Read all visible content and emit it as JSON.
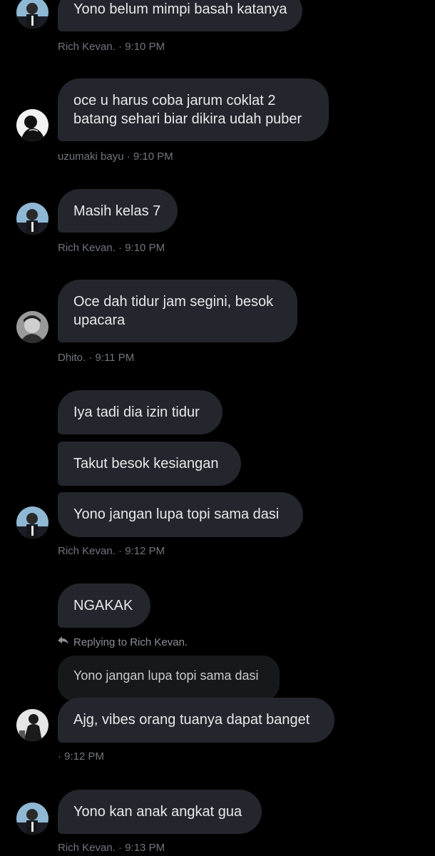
{
  "conversation": {
    "messages": [
      {
        "text": "Yono belum mimpi basah katanya",
        "meta": "Rich Kevan. · 9:10 PM"
      },
      {
        "text_lines": [
          "oce u harus coba jarum coklat 2",
          "batang sehari biar dikira udah puber"
        ],
        "meta": "uzumaki bayu · 9:10 PM"
      },
      {
        "text": "Masih kelas 7",
        "meta": "Rich Kevan. · 9:10 PM"
      },
      {
        "text_lines": [
          "Oce dah tidur jam segini, besok",
          "upacara"
        ],
        "meta": "Dhito. · 9:11 PM"
      },
      {
        "group": [
          "Iya tadi dia izin tidur",
          "Takut besok kesiangan",
          "Yono jangan lupa topi sama dasi"
        ],
        "meta": "Rich Kevan. · 9:12 PM"
      },
      {
        "text": "NGAKAK"
      },
      {
        "reply_label": "Replying to Rich Kevan.",
        "quoted_text": "Yono jangan lupa topi sama dasi",
        "text": "Ajg, vibes orang tuanya dapat banget",
        "meta": "· 9:12 PM"
      },
      {
        "text": "Yono kan anak angkat gua",
        "meta": "Rich Kevan. · 9:13 PM"
      }
    ]
  },
  "icons": {
    "reply": "reply-arrow-icon"
  },
  "colors": {
    "background": "#000000",
    "bubble": "#23272d",
    "quoted_bubble": "#16191c",
    "text": "#e7e9ea",
    "meta": "#71767b"
  }
}
